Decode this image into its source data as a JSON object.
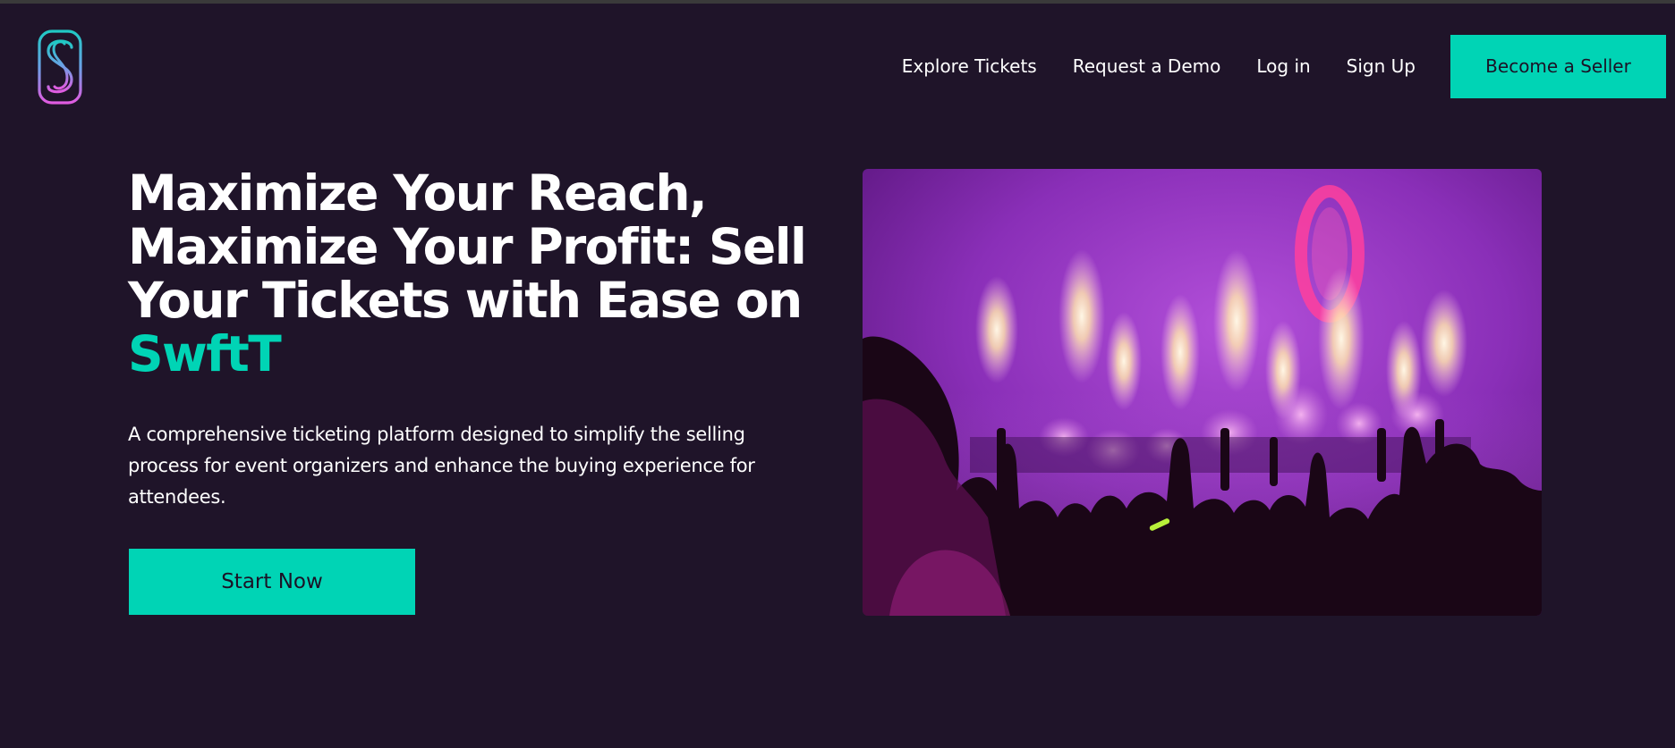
{
  "brand": {
    "logo_icon": "swftt-s-logo-icon",
    "accent_color": "#00d4b5",
    "background_color": "#1f1429"
  },
  "nav": {
    "explore": "Explore Tickets",
    "demo": "Request a Demo",
    "login": "Log in",
    "signup": "Sign Up",
    "seller_button": "Become a Seller"
  },
  "hero": {
    "title_main": "Maximize Your Reach, Maximize Your Profit: Sell Your Tickets with Ease on",
    "title_brand": "SwftT",
    "description": "A comprehensive ticketing platform designed to simplify the selling process for event organizers and enhance the buying experience for attendees.",
    "cta": "Start Now",
    "image_icon": "concert-crowd-fireworks-photo"
  }
}
